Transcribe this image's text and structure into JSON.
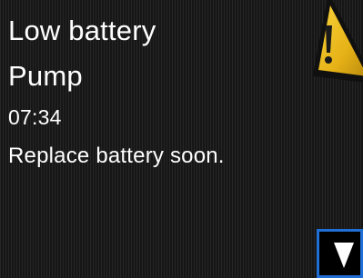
{
  "alert": {
    "title": "Low battery",
    "device": "Pump",
    "time": "07:34",
    "message": "Replace battery soon."
  },
  "icons": {
    "warning": "warning-triangle-icon",
    "scroll_down": "down-arrow-icon"
  },
  "colors": {
    "background": "#1b1b1b",
    "text": "#ffffff",
    "warning_yellow": "#f2c21b",
    "selection_outline": "#1f6fd6"
  }
}
